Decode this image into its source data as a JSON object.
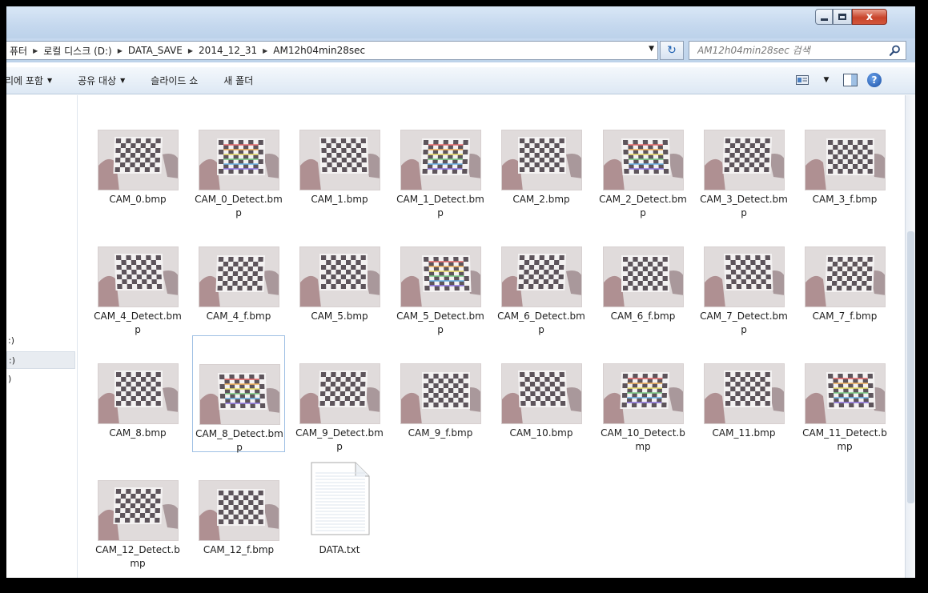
{
  "window": {
    "close_glyph": "x"
  },
  "address": {
    "crumbs": [
      "퓨터",
      "로컬 디스크 (D:)",
      "DATA_SAVE",
      "2014_12_31",
      "AM12h04min28sec"
    ]
  },
  "search": {
    "placeholder": "AM12h04min28sec 검색"
  },
  "commands": {
    "include": "리에 포함",
    "share": "공유 대상",
    "slideshow": "슬라이드 쇼",
    "new_folder": "새 폴더"
  },
  "nav": {
    "items": [
      ":)",
      ":)",
      ")"
    ]
  },
  "files": [
    {
      "name": "CAM_0.bmp",
      "type": "image",
      "detect": false
    },
    {
      "name": "CAM_0_Detect.bmp",
      "type": "image",
      "detect": true
    },
    {
      "name": "CAM_1.bmp",
      "type": "image",
      "detect": false
    },
    {
      "name": "CAM_1_Detect.bmp",
      "type": "image",
      "detect": true
    },
    {
      "name": "CAM_2.bmp",
      "type": "image",
      "detect": false
    },
    {
      "name": "CAM_2_Detect.bmp",
      "type": "image",
      "detect": true
    },
    {
      "name": "CAM_3_Detect.bmp",
      "type": "image",
      "detect": false
    },
    {
      "name": "CAM_3_f.bmp",
      "type": "image",
      "detect": false
    },
    {
      "name": "CAM_4_Detect.bmp",
      "type": "image",
      "detect": false
    },
    {
      "name": "CAM_4_f.bmp",
      "type": "image",
      "detect": false
    },
    {
      "name": "CAM_5.bmp",
      "type": "image",
      "detect": false
    },
    {
      "name": "CAM_5_Detect.bmp",
      "type": "image",
      "detect": true
    },
    {
      "name": "CAM_6_Detect.bmp",
      "type": "image",
      "detect": false
    },
    {
      "name": "CAM_6_f.bmp",
      "type": "image",
      "detect": false
    },
    {
      "name": "CAM_7_Detect.bmp",
      "type": "image",
      "detect": false
    },
    {
      "name": "CAM_7_f.bmp",
      "type": "image",
      "detect": false
    },
    {
      "name": "CAM_8.bmp",
      "type": "image",
      "detect": false
    },
    {
      "name": "CAM_8_Detect.bmp",
      "type": "image",
      "detect": true,
      "selected": true
    },
    {
      "name": "CAM_9_Detect.bmp",
      "type": "image",
      "detect": false
    },
    {
      "name": "CAM_9_f.bmp",
      "type": "image",
      "detect": false
    },
    {
      "name": "CAM_10.bmp",
      "type": "image",
      "detect": false
    },
    {
      "name": "CAM_10_Detect.bmp",
      "type": "image",
      "detect": true
    },
    {
      "name": "CAM_11.bmp",
      "type": "image",
      "detect": false
    },
    {
      "name": "CAM_11_Detect.bmp",
      "type": "image",
      "detect": true
    },
    {
      "name": "CAM_12_Detect.bmp",
      "type": "image",
      "detect": false
    },
    {
      "name": "CAM_12_f.bmp",
      "type": "image",
      "detect": false
    },
    {
      "name": "DATA.txt",
      "type": "text",
      "detect": false
    }
  ],
  "colors": {
    "selection_border": "#9fc0e4",
    "titlebar": "#c5d8ee",
    "close_button": "#c8442b"
  }
}
